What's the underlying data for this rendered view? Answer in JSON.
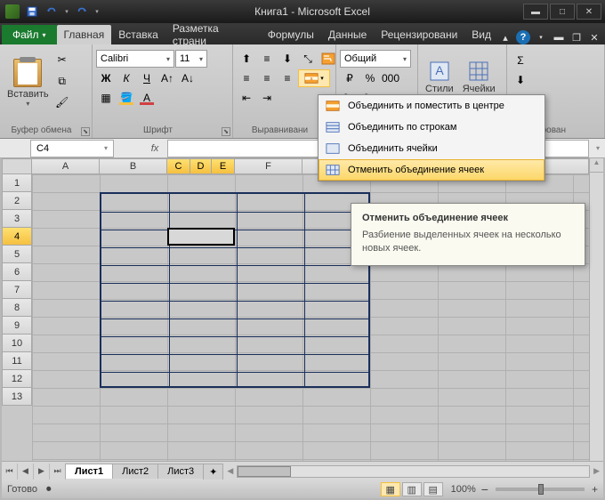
{
  "title": "Книга1 - Microsoft Excel",
  "tabs": {
    "file": "Файл",
    "home": "Главная",
    "insert": "Вставка",
    "pagelayout": "Разметка страни",
    "formulas": "Формулы",
    "data": "Данные",
    "review": "Рецензировани",
    "view": "Вид"
  },
  "ribbon": {
    "clipboard": {
      "paste": "Вставить",
      "label": "Буфер обмена"
    },
    "font": {
      "name": "Calibri",
      "size": "11",
      "label": "Шрифт"
    },
    "alignment": {
      "label": "Выравнивани"
    },
    "number": {
      "format": "Общий",
      "label": ""
    },
    "styles": {
      "styles": "Стили",
      "cells": "Ячейки"
    },
    "editing": {
      "label": "ирован"
    }
  },
  "namebox": "C4",
  "fx": "fx",
  "columns": [
    "A",
    "B",
    "C",
    "D",
    "E",
    "F"
  ],
  "rows": [
    "1",
    "2",
    "3",
    "4",
    "5",
    "6",
    "7",
    "8",
    "9",
    "10",
    "11",
    "12",
    "13"
  ],
  "selected_cols": [
    "C",
    "D",
    "E"
  ],
  "selected_row": "4",
  "dropdown": {
    "items": [
      "Объединить и поместить в центре",
      "Объединить по строкам",
      "Объединить ячейки",
      "Отменить объединение ячеек"
    ],
    "active_index": 3
  },
  "tooltip": {
    "title": "Отменить объединение ячеек",
    "body": "Разбиение выделенных ячеек на несколько новых ячеек."
  },
  "sheets": {
    "s1": "Лист1",
    "s2": "Лист2",
    "s3": "Лист3"
  },
  "status": {
    "ready": "Готово",
    "zoom": "100%",
    "minus": "−",
    "plus": "+"
  }
}
